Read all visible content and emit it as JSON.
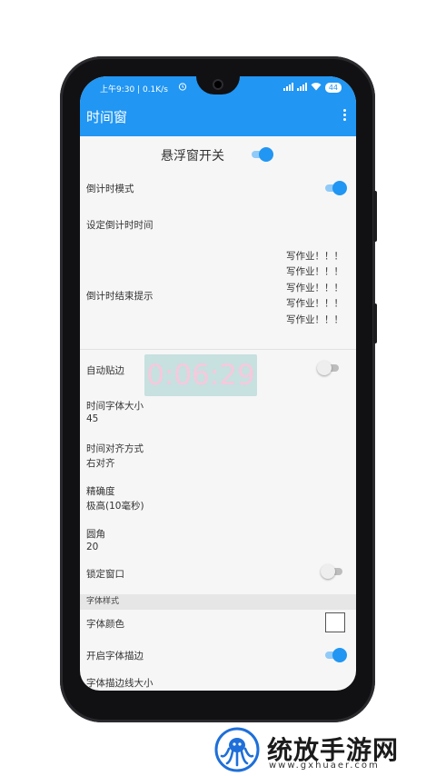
{
  "status_bar": {
    "left_text": "上午9:30 | 0.1K/s",
    "battery": "44"
  },
  "app_bar": {
    "title": "时间窗"
  },
  "settings": {
    "floating_switch_label": "悬浮窗开关",
    "countdown_mode_label": "倒计时模式",
    "set_countdown_label": "设定倒计时时间",
    "countdown_end_label": "倒计时结束提示",
    "countdown_end_messages": [
      "写作业！！！",
      "写作业！！！",
      "写作业！！！",
      "写作业！！！",
      "写作业！！！"
    ],
    "auto_snap_label": "自动贴边",
    "font_size_label": "时间字体大小",
    "font_size_value": "45",
    "alignment_label": "时间对齐方式",
    "alignment_value": "右对齐",
    "precision_label": "精确度",
    "precision_value": "极高(10毫秒)",
    "corner_label": "圆角",
    "corner_value": "20",
    "lock_window_label": "锁定窗口",
    "font_style_section": "字体样式",
    "font_color_label": "字体颜色",
    "stroke_enable_label": "开启字体描边",
    "stroke_size_label": "字体描边线大小"
  },
  "timer_display": "0:06:29",
  "watermark": {
    "text": "统放手游网",
    "url": "www.gxhuaer.com"
  },
  "colors": {
    "accent": "#2196f3",
    "accent_light": "#90caf9",
    "timer_text": "#f6c9dd"
  }
}
